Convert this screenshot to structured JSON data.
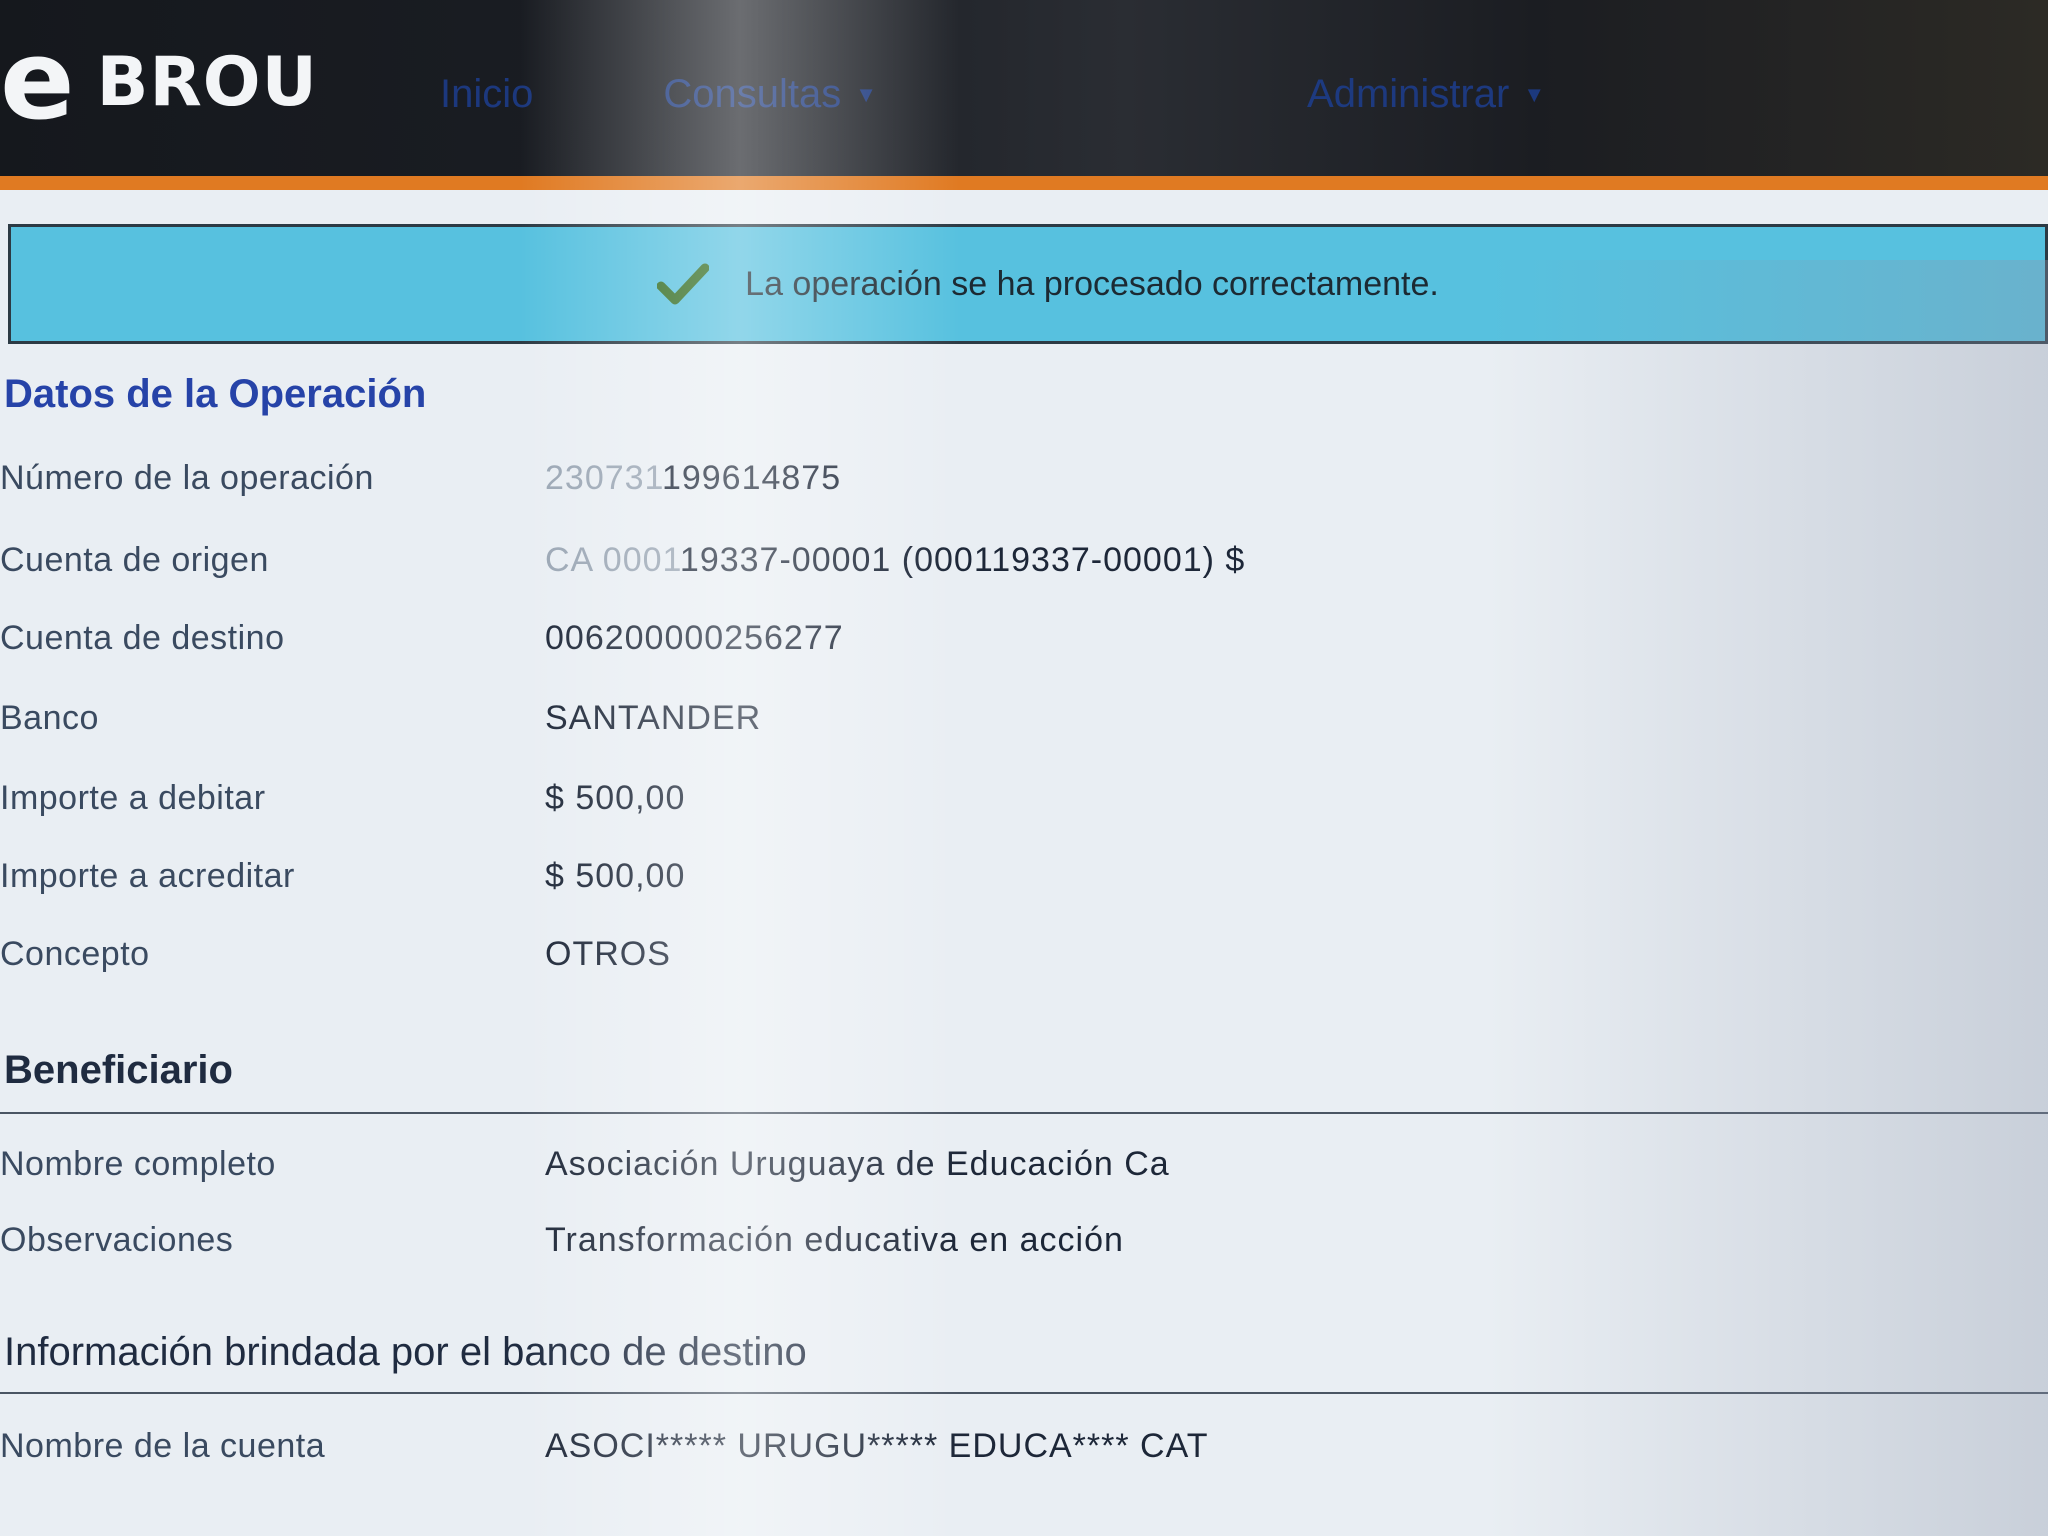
{
  "header": {
    "logo_e": "e",
    "logo_text": "BROU",
    "nav": {
      "inicio": "Inicio",
      "consultas": "Consultas",
      "administrar": "Administrar"
    }
  },
  "banner": {
    "message": "La operación se ha procesado correctamente."
  },
  "operacion": {
    "title": "Datos de la Operación",
    "rows": [
      {
        "label": "Número de la operación",
        "value_faded": "230731",
        "value": "199614875"
      },
      {
        "label": "Cuenta de origen",
        "value_faded": "CA 0001",
        "value": "19337-00001 (000119337-00001) $"
      },
      {
        "label": "Cuenta de destino",
        "value_faded": "",
        "value": "006200000256277"
      },
      {
        "label": "Banco",
        "value_faded": "",
        "value": "SANTANDER"
      },
      {
        "label": "Importe a debitar",
        "value_faded": "",
        "value": "$ 500,00"
      },
      {
        "label": "Importe a acreditar",
        "value_faded": "",
        "value": "$ 500,00"
      },
      {
        "label": "Concepto",
        "value_faded": "",
        "value": "OTROS"
      }
    ]
  },
  "beneficiario": {
    "title": "Beneficiario",
    "rows": [
      {
        "label": "Nombre completo",
        "value": "Asociación Uruguaya de Educación Ca"
      },
      {
        "label": "Observaciones",
        "value": "Transformación educativa en acción"
      }
    ]
  },
  "banco_destino": {
    "title": "Información brindada por el banco de destino",
    "rows": [
      {
        "label": "Nombre de la cuenta",
        "value": "ASOCI***** URUGU***** EDUCA**** CAT"
      }
    ]
  },
  "colors": {
    "banner": "#57c1df",
    "accent_orange": "#e07a22",
    "title_blue": "#2643a8",
    "check_green": "#2f6a1f"
  }
}
